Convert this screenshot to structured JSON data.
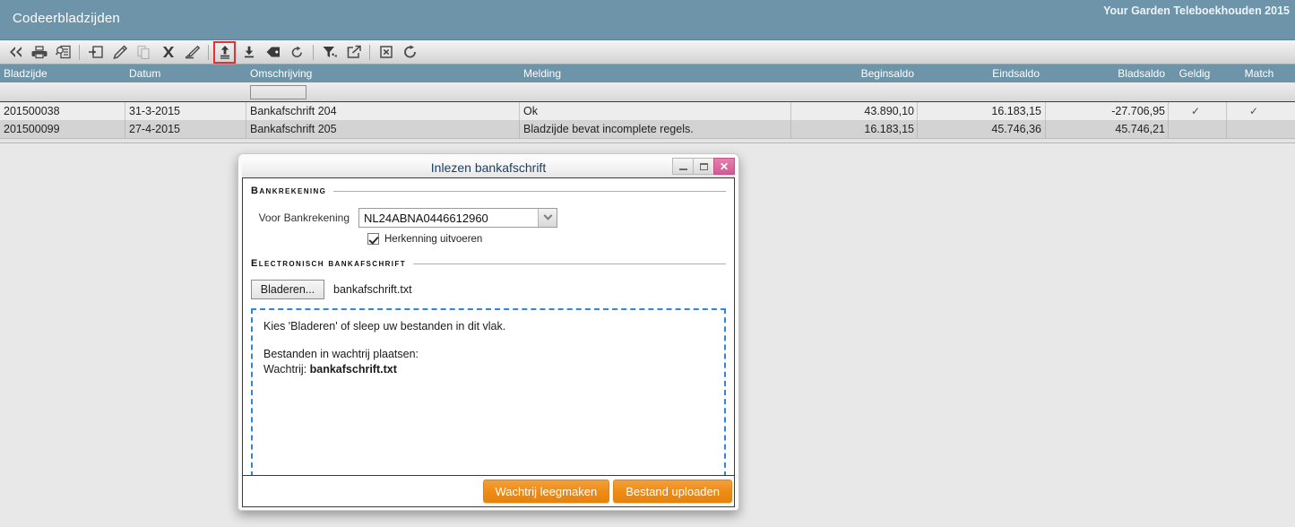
{
  "header": {
    "app_title": "Codeerbladzijden",
    "company": "Your Garden Teleboekhouden 2015"
  },
  "toolbar": {
    "items": [
      {
        "name": "first-page-icon",
        "label": "Eerste"
      },
      {
        "name": "print-icon",
        "label": "Afdrukken"
      },
      {
        "name": "print-preview-icon",
        "label": "Afdrukvoorbeeld"
      },
      {
        "name": "add-record-icon",
        "label": "Toevoegen"
      },
      {
        "name": "edit-icon",
        "label": "Wijzigen"
      },
      {
        "name": "copy-icon",
        "label": "Kopieren"
      },
      {
        "name": "delete-icon",
        "label": "Verwijderen"
      },
      {
        "name": "highlight-icon",
        "label": "Markeren"
      },
      {
        "name": "upload-icon",
        "label": "Inlezen bankafschrift"
      },
      {
        "name": "download-icon",
        "label": "Exporteren"
      },
      {
        "name": "tag-icon",
        "label": "Label"
      },
      {
        "name": "refresh-undo-icon",
        "label": "Ongedaan maken"
      },
      {
        "name": "filter-icon",
        "label": "Filter"
      },
      {
        "name": "open-external-icon",
        "label": "Openen"
      },
      {
        "name": "export-excel-icon",
        "label": "Excel"
      },
      {
        "name": "reload-icon",
        "label": "Vernieuwen"
      }
    ],
    "highlighted": "upload-icon"
  },
  "grid": {
    "columns": [
      {
        "key": "bladzijde",
        "label": "Bladzijde"
      },
      {
        "key": "datum",
        "label": "Datum"
      },
      {
        "key": "omschrijving",
        "label": "Omschrijving"
      },
      {
        "key": "melding",
        "label": "Melding"
      },
      {
        "key": "beginsaldo",
        "label": "Beginsaldo"
      },
      {
        "key": "eindsaldo",
        "label": "Eindsaldo"
      },
      {
        "key": "bladsaldo",
        "label": "Bladsaldo"
      },
      {
        "key": "geldig",
        "label": "Geldig"
      },
      {
        "key": "match",
        "label": "Match"
      }
    ],
    "filter_value": "",
    "rows": [
      {
        "bladzijde": "201500038",
        "datum": "31-3-2015",
        "omschrijving": "Bankafschrift 204",
        "melding": "Ok",
        "beginsaldo": "43.890,10",
        "eindsaldo": "16.183,15",
        "bladsaldo": "-27.706,95",
        "geldig": "✓",
        "match": "✓"
      },
      {
        "bladzijde": "201500099",
        "datum": "27-4-2015",
        "omschrijving": "Bankafschrift 205",
        "melding": "Bladzijde bevat incomplete regels.",
        "beginsaldo": "16.183,15",
        "eindsaldo": "45.746,36",
        "bladsaldo": "45.746,21",
        "geldig": "",
        "match": ""
      }
    ]
  },
  "dialog": {
    "title": "Inlezen bankafschrift",
    "window_buttons": {
      "minimize": "–",
      "maximize": "□",
      "close": "✕"
    },
    "section_bankrekening": {
      "legend": "Bankrekening",
      "field_label": "Voor Bankrekening",
      "account_value": "NL24ABNA0446612960",
      "checkbox_label": "Herkenning uitvoeren",
      "checkbox_checked": true
    },
    "section_afschrift": {
      "legend": "Electronisch bankafschrift",
      "browse_button": "Bladeren...",
      "selected_file": "bankafschrift.txt",
      "dropzone": {
        "line1": "Kies 'Bladeren' of sleep uw bestanden in dit vlak.",
        "line2": "Bestanden in wachtrij plaatsen:",
        "line3_prefix": "Wachtrij: ",
        "line3_file": "bankafschrift.txt"
      }
    },
    "footer": {
      "clear_queue_button": "Wachtrij leegmaken",
      "upload_button": "Bestand uploaden"
    }
  },
  "colors": {
    "header_blue": "#6d94a8",
    "accent_orange": "#ef8c16",
    "dropzone_blue": "#2f86e0",
    "highlight_red": "#ef2d2d"
  }
}
